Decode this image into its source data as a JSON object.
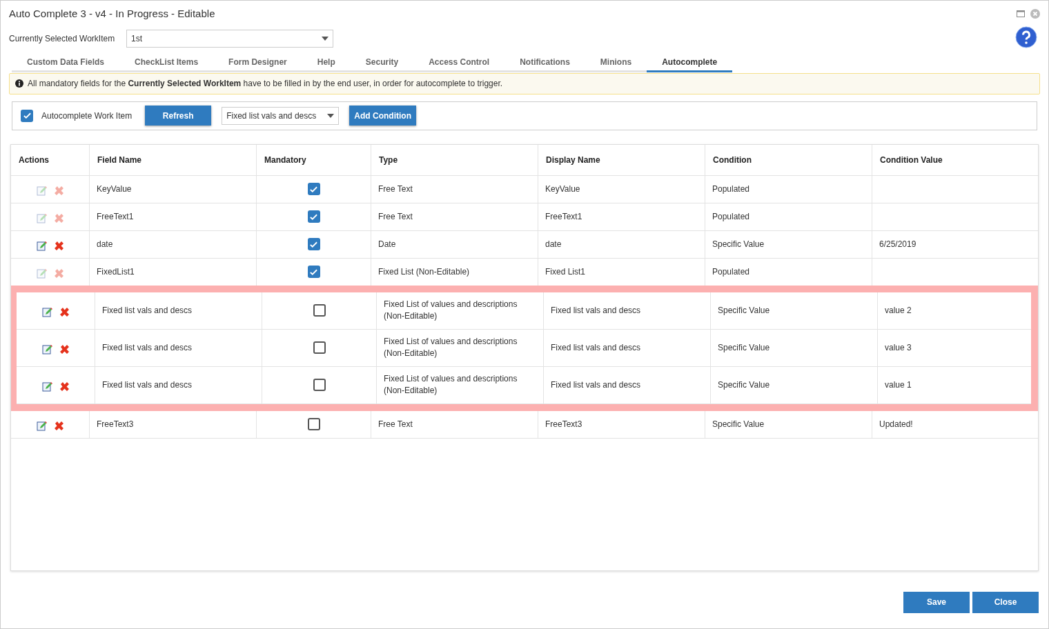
{
  "window": {
    "title": "Auto Complete 3 - v4 - In Progress - Editable"
  },
  "workitem": {
    "label": "Currently Selected WorkItem",
    "value": "1st"
  },
  "tabs": [
    {
      "label": "Custom Data Fields",
      "selected": false
    },
    {
      "label": "CheckList Items",
      "selected": false
    },
    {
      "label": "Form Designer",
      "selected": false
    },
    {
      "label": "Help",
      "selected": false
    },
    {
      "label": "Security",
      "selected": false
    },
    {
      "label": "Access Control",
      "selected": false
    },
    {
      "label": "Notifications",
      "selected": false
    },
    {
      "label": "Minions",
      "selected": false
    },
    {
      "label": "Autocomplete",
      "selected": true
    }
  ],
  "notice": "All mandatory fields for the **Currently Selected WorkItem** have to be filled in by the end user, in order for autocomplete to trigger.",
  "toolbar": {
    "autocomplete": {
      "label": "Autocomplete Work Item",
      "checked": true
    },
    "refresh": "Refresh",
    "field_select": "Fixed list vals and descs",
    "add": "Add Condition"
  },
  "table": {
    "columns": [
      "Actions",
      "Field Name",
      "Mandatory",
      "Type",
      "Display Name",
      "Condition",
      "Condition Value"
    ],
    "rows": [
      {
        "actions_enabled": false,
        "highlighted": false,
        "field": "KeyValue",
        "mandatory": true,
        "type": "Free Text",
        "display": "KeyValue",
        "condition": "Populated"
      },
      {
        "actions_enabled": false,
        "highlighted": false,
        "field": "FreeText1",
        "mandatory": true,
        "type": "Free Text",
        "display": "FreeText1",
        "condition": "Populated"
      },
      {
        "actions_enabled": true,
        "highlighted": false,
        "field": "date",
        "mandatory": true,
        "type": "Date",
        "display": "date",
        "condition": "Specific Value",
        "value": "6/25/2019"
      },
      {
        "actions_enabled": false,
        "highlighted": false,
        "field": "FixedList1",
        "mandatory": true,
        "type": "Fixed List (Non-Editable)",
        "display": "Fixed List1",
        "condition": "Populated"
      },
      {
        "actions_enabled": true,
        "highlighted": true,
        "field": "Fixed list vals and descs",
        "mandatory": false,
        "type": "Fixed List of values and descriptions (Non-Editable)",
        "display": "Fixed list vals and descs",
        "condition": "Specific Value",
        "value": "value 2"
      },
      {
        "actions_enabled": true,
        "highlighted": true,
        "field": "Fixed list vals and descs",
        "mandatory": false,
        "type": "Fixed List of values and descriptions (Non-Editable)",
        "display": "Fixed list vals and descs",
        "condition": "Specific Value",
        "value": "value 3"
      },
      {
        "actions_enabled": true,
        "highlighted": true,
        "field": "Fixed list vals and descs",
        "mandatory": false,
        "type": "Fixed List of values and descriptions (Non-Editable)",
        "display": "Fixed list vals and descs",
        "condition": "Specific Value",
        "value": "value 1"
      },
      {
        "actions_enabled": true,
        "highlighted": false,
        "field": "FreeText3",
        "mandatory": false,
        "type": "Free Text",
        "display": "FreeText3",
        "condition": "Specific Value",
        "value": "Updated!"
      }
    ]
  },
  "footer": {
    "save": "Save",
    "close": "Close"
  }
}
